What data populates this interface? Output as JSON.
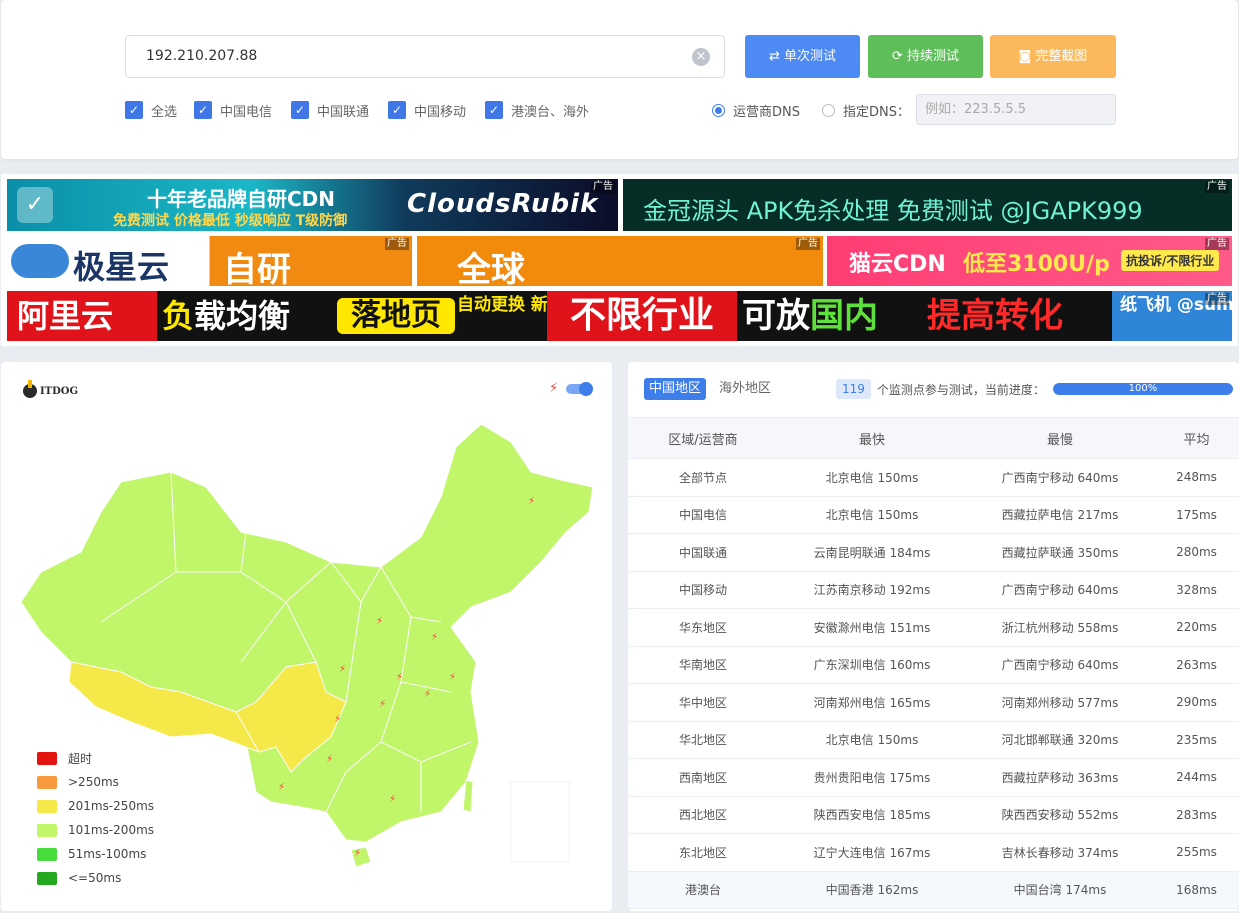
{
  "search": {
    "value": "192.210.207.88"
  },
  "buttons": {
    "single": "单次测试",
    "continuous": "持续测试",
    "screenshot": "完整截图"
  },
  "filters": [
    {
      "label": "全选",
      "checked": true
    },
    {
      "label": "中国电信",
      "checked": true
    },
    {
      "label": "中国联通",
      "checked": true
    },
    {
      "label": "中国移动",
      "checked": true
    },
    {
      "label": "港澳台、海外",
      "checked": true
    }
  ],
  "dns": {
    "option_isp": "运营商DNS",
    "option_custom": "指定DNS：",
    "placeholder": "例如：223.5.5.5",
    "selected": "运营商DNS"
  },
  "ads": {
    "tag": "广告",
    "ad1": {
      "title": "十年老品牌自研CDN",
      "subtitle": "免费测试 价格最低 秒级响应 T级防御",
      "brand": "CloudsRubik"
    },
    "ad2": {
      "text": "金冠源头 APK免杀处理 免费测试 @JGAPK999"
    },
    "ad3": {
      "brand": "极星云",
      "word": "自研"
    },
    "ad4": {
      "word": "全球"
    },
    "ad5": {
      "name": "猫云CDN",
      "price": "低至3100U/p",
      "note": "抗投诉/不限行业"
    },
    "ad6": {
      "s1": "阿里云",
      "s2a": "负",
      "s2b": "载均衡",
      "s3": "落地页",
      "s4": "自动更换 新 域 名",
      "s5": "不限行业",
      "s6a": "可放",
      "s6b": "国内",
      "s7": "提高转化",
      "s8": "纸飞机 @summerbg"
    }
  },
  "map": {
    "logo": "ITDOG",
    "legend": [
      {
        "label": "超时",
        "color": "#e3140f"
      },
      {
        "label": ">250ms",
        "color": "#f79a3d"
      },
      {
        "label": "201ms-250ms",
        "color": "#f5e94a"
      },
      {
        "label": "101ms-200ms",
        "color": "#c1f56a"
      },
      {
        "label": "51ms-100ms",
        "color": "#48db3c"
      },
      {
        "label": "<=50ms",
        "color": "#23a81f"
      }
    ]
  },
  "stats": {
    "tabs": [
      "中国地区",
      "海外地区"
    ],
    "active_tab": "中国地区",
    "node_count": "119",
    "progress_text": "个监测点参与测试，当前进度：",
    "progress_label": "100%",
    "progress": 1.0,
    "headers": [
      "区域/运营商",
      "最快",
      "最慢",
      "平均"
    ],
    "rows": [
      [
        "全部节点",
        "北京电信 150ms",
        "广西南宁移动 640ms",
        "248ms"
      ],
      [
        "中国电信",
        "北京电信 150ms",
        "西藏拉萨电信 217ms",
        "175ms"
      ],
      [
        "中国联通",
        "云南昆明联通 184ms",
        "西藏拉萨联通 350ms",
        "280ms"
      ],
      [
        "中国移动",
        "江苏南京移动 192ms",
        "广西南宁移动 640ms",
        "328ms"
      ],
      [
        "华东地区",
        "安徽滁州电信 151ms",
        "浙江杭州移动 558ms",
        "220ms"
      ],
      [
        "华南地区",
        "广东深圳电信 160ms",
        "广西南宁移动 640ms",
        "263ms"
      ],
      [
        "华中地区",
        "河南郑州电信 165ms",
        "河南郑州移动 577ms",
        "290ms"
      ],
      [
        "华北地区",
        "北京电信 150ms",
        "河北邯郸联通 320ms",
        "235ms"
      ],
      [
        "西南地区",
        "贵州贵阳电信 175ms",
        "西藏拉萨移动 363ms",
        "244ms"
      ],
      [
        "西北地区",
        "陕西西安电信 185ms",
        "陕西西安移动 552ms",
        "283ms"
      ],
      [
        "东北地区",
        "辽宁大连电信 167ms",
        "吉林长春移动 374ms",
        "255ms"
      ],
      [
        "港澳台",
        "中国香港 162ms",
        "中国台湾 174ms",
        "168ms"
      ]
    ]
  }
}
